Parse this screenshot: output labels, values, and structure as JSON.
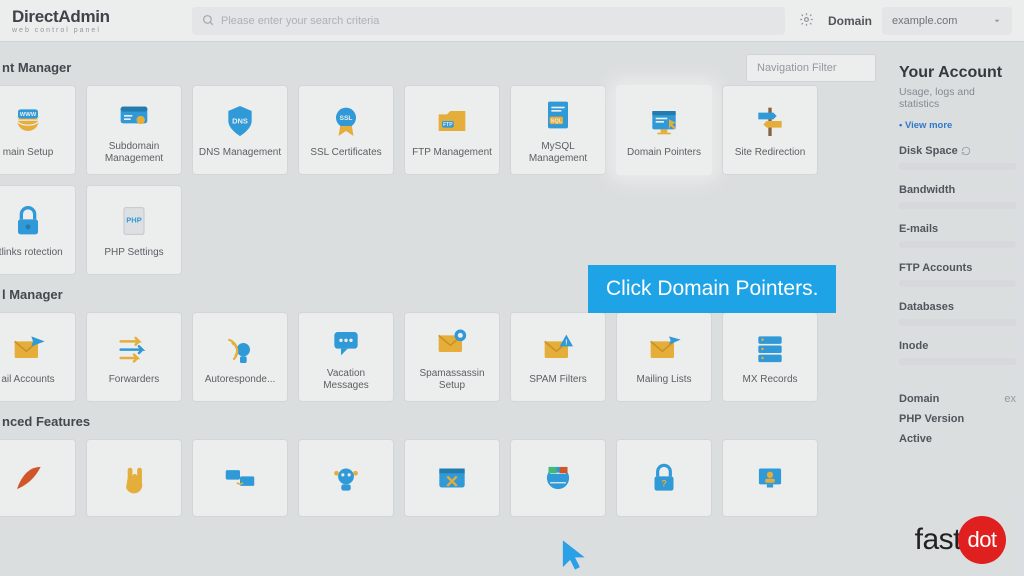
{
  "brand": {
    "name": "DirectAdmin",
    "subtitle": "web control panel"
  },
  "search": {
    "placeholder": "Please enter your search criteria"
  },
  "header": {
    "domain_label": "Domain",
    "domain_value": "example.com"
  },
  "nav_filter_placeholder": "Navigation Filter",
  "sections": {
    "account_manager": {
      "title": "nt Manager",
      "tiles": [
        {
          "name": "domain-setup",
          "label": "main Setup"
        },
        {
          "name": "subdomain-management",
          "label": "Subdomain Management"
        },
        {
          "name": "dns-management",
          "label": "DNS Management"
        },
        {
          "name": "ssl-certificates",
          "label": "SSL Certificates"
        },
        {
          "name": "ftp-management",
          "label": "FTP Management"
        },
        {
          "name": "mysql-management",
          "label": "MySQL Management"
        },
        {
          "name": "domain-pointers",
          "label": "Domain Pointers",
          "highlight": true
        },
        {
          "name": "site-redirection",
          "label": "Site Redirection"
        },
        {
          "name": "hotlinks-protection",
          "label": "otlinks rotection"
        },
        {
          "name": "php-settings",
          "label": "PHP Settings"
        }
      ]
    },
    "mail_manager": {
      "title": "l Manager",
      "tiles": [
        {
          "name": "email-accounts",
          "label": "ail Accounts"
        },
        {
          "name": "forwarders",
          "label": "Forwarders"
        },
        {
          "name": "autoresponders",
          "label": "Autoresponde..."
        },
        {
          "name": "vacation-messages",
          "label": "Vacation Messages"
        },
        {
          "name": "spamassassin-setup",
          "label": "Spamassassin Setup"
        },
        {
          "name": "spam-filters",
          "label": "SPAM Filters"
        },
        {
          "name": "mailing-lists",
          "label": "Mailing Lists"
        },
        {
          "name": "mx-records",
          "label": "MX Records"
        }
      ]
    },
    "advanced_features": {
      "title": "nced Features"
    }
  },
  "sidebar": {
    "heading": "Your Account",
    "subtext": "Usage, logs and statistics",
    "view_more": "• View more",
    "stats": [
      {
        "label": "Disk Space"
      },
      {
        "label": "Bandwidth"
      },
      {
        "label": "E-mails"
      },
      {
        "label": "FTP Accounts"
      },
      {
        "label": "Databases"
      },
      {
        "label": "Inode"
      }
    ],
    "info_rows": [
      {
        "label": "Domain",
        "value": "ex"
      },
      {
        "label": "PHP Version"
      },
      {
        "label": "Active"
      }
    ]
  },
  "callout_text": "Click Domain Pointers.",
  "footer_brand": {
    "prefix": "fast",
    "suffix": "dot"
  }
}
